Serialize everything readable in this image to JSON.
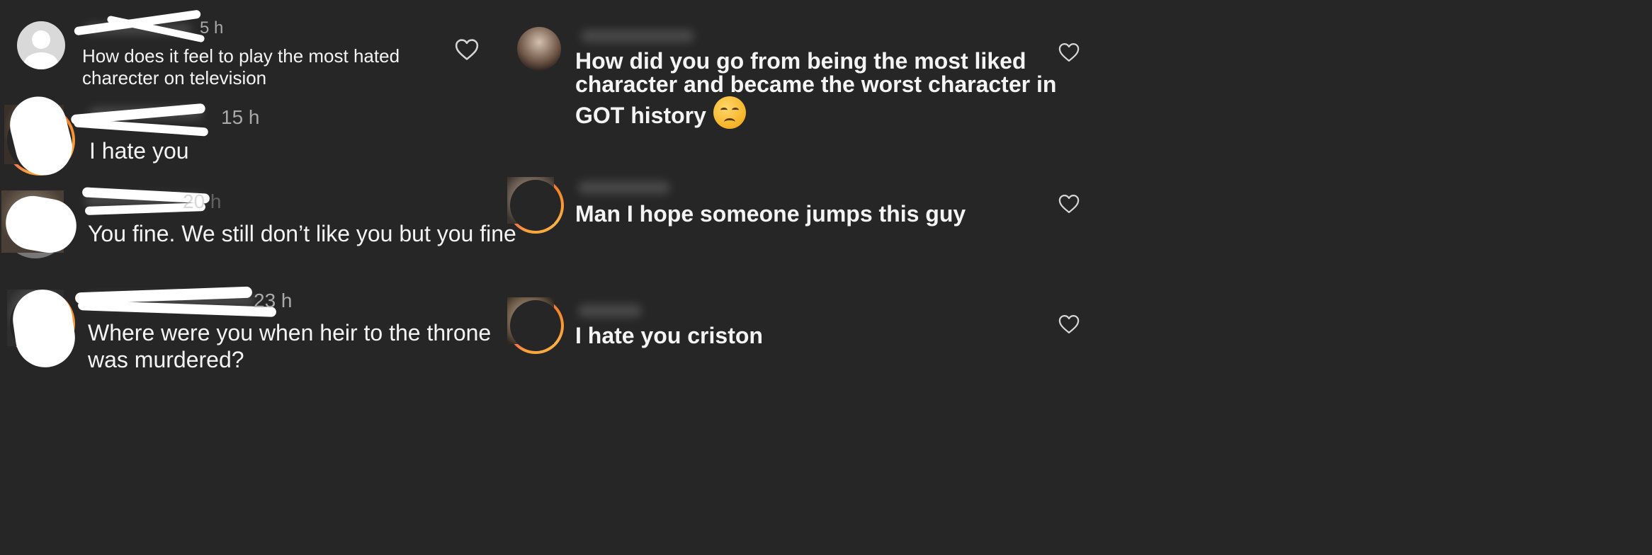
{
  "left_comments": [
    {
      "time": "5 h",
      "text_lines": [
        "How does it feel to play the most hated",
        "charecter on television"
      ]
    },
    {
      "time": "15 h",
      "text_lines": [
        "I hate you"
      ]
    },
    {
      "time": "20 h",
      "text_lines": [
        "You fine. We still don’t like you but you fine"
      ]
    },
    {
      "time": "23 h",
      "text_lines": [
        "Where were you when heir to the throne",
        "was murdered?"
      ]
    }
  ],
  "right_comments": [
    {
      "text_lines": [
        "How did you go from being the most liked",
        "character and became the worst character in",
        "GOT history"
      ],
      "emoji": "disappointed-face"
    },
    {
      "text_lines": [
        "Man I hope someone jumps this guy"
      ]
    },
    {
      "text_lines": [
        "I hate you criston"
      ]
    }
  ],
  "icons": {
    "like": "heart-outline-icon",
    "default_avatar": "default-user-avatar-icon"
  },
  "colors": {
    "background": "#262626",
    "text": "#f4f4f4",
    "secondary_text": "#a9a9a9",
    "story_ring_start": "#f9a23a",
    "story_ring_end": "#c13584"
  }
}
